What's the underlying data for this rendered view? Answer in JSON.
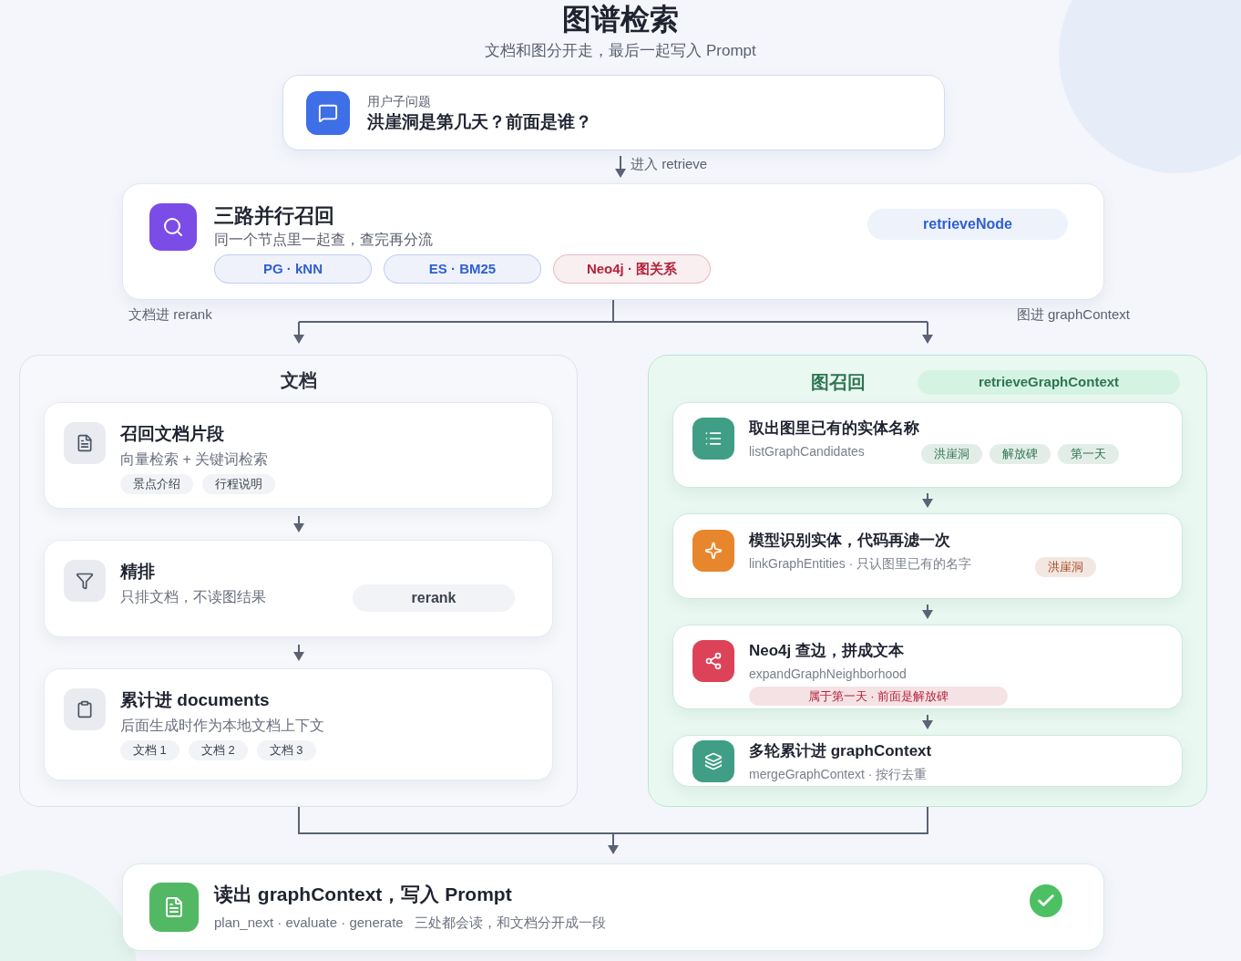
{
  "header": {
    "title": "图谱检索",
    "subtitle": "文档和图分开走，最后一起写入 Prompt"
  },
  "question": {
    "label": "用户子问题",
    "text": "洪崖洞是第几天？前面是谁？"
  },
  "step_label": "进入 retrieve",
  "retrieve": {
    "title": "三路并行召回",
    "subtitle": "同一个节点里一起查，查完再分流",
    "node": "retrieveNode",
    "sources": [
      {
        "label": "PG · kNN",
        "color": "#2f5fd0"
      },
      {
        "label": "ES · BM25",
        "color": "#2f5fd0"
      },
      {
        "label": "Neo4j · 图关系",
        "color": "#b4233c"
      }
    ]
  },
  "branch_labels": {
    "left": "文档进 rerank",
    "right": "图进 graphContext"
  },
  "docs_panel": {
    "title": "文档",
    "steps": [
      {
        "kind": "file",
        "title": "召回文档片段",
        "subtitle": "向量检索 + 关键词检索",
        "tags": [
          "景点介绍",
          "行程说明"
        ]
      },
      {
        "kind": "filter",
        "title": "精排",
        "subtitle": "只排文档，不读图结果",
        "badge": "rerank"
      },
      {
        "kind": "clipboard",
        "title": "累计进 documents",
        "subtitle": "后面生成时作为本地文档上下文",
        "tags": [
          "文档 1",
          "文档 2",
          "文档 3"
        ]
      }
    ]
  },
  "graph_panel": {
    "title": "图召回",
    "node": "retrieveGraphContext",
    "steps": [
      {
        "kind": "list",
        "color": "#3f9e85",
        "title": "取出图里已有的实体名称",
        "subtitle": "listGraphCandidates",
        "tags": [
          {
            "label": "洪崖洞",
            "color": "#2e7550"
          },
          {
            "label": "解放碑",
            "color": "#2e7550"
          },
          {
            "label": "第一天",
            "color": "#2e7550"
          }
        ]
      },
      {
        "kind": "sparkle",
        "color": "#e8862e",
        "title": "模型识别实体，代码再滤一次",
        "subtitle": "linkGraphEntities · 只认图里已有的名字",
        "tags": [
          {
            "label": "洪崖洞",
            "color": "#a8481f"
          }
        ]
      },
      {
        "kind": "share",
        "color": "#dc4358",
        "title": "Neo4j 查边，拼成文本",
        "subtitle": "expandGraphNeighborhood",
        "note": {
          "label": "属于第一天 · 前面是解放碑",
          "color": "#b4233c"
        }
      },
      {
        "kind": "layers",
        "color": "#3f9e85",
        "title": "多轮累计进 graphContext",
        "subtitle": "mergeGraphContext · 按行去重"
      }
    ]
  },
  "output": {
    "title": "读出 graphContext，写入 Prompt",
    "subtitle": "plan_next · evaluate · generate   三处都会读，和文档分开成一段"
  }
}
